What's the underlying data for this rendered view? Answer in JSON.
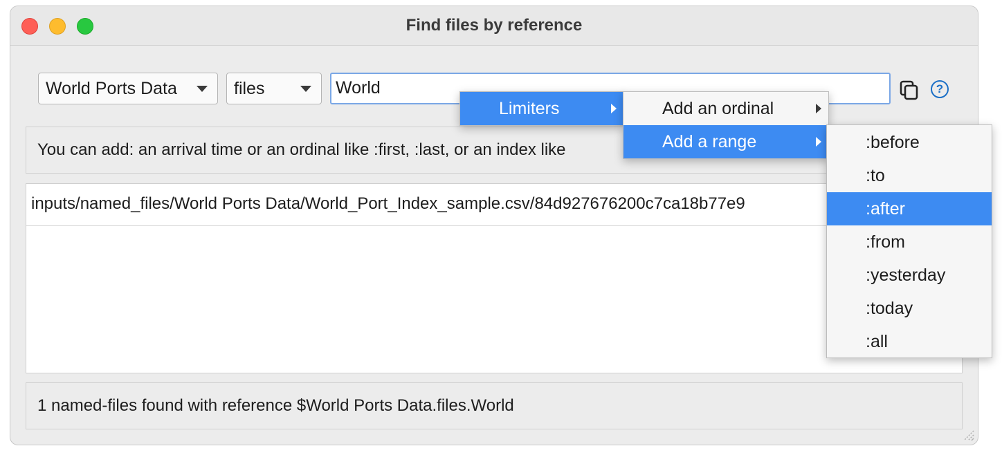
{
  "window": {
    "title": "Find files by reference"
  },
  "toolbar": {
    "dataset_value": "World Ports Data",
    "type_value": "files",
    "search_value": "World",
    "help_glyph": "?"
  },
  "hint": {
    "text": "You can add: an arrival time or an ordinal like :first, :last, or an index like"
  },
  "results": {
    "rows": [
      "inputs/named_files/World Ports Data/World_Port_Index_sample.csv/84d927676200c7ca18b77e9"
    ]
  },
  "status": {
    "text": "1 named-files found with reference $World Ports Data.files.World"
  },
  "context_menu": {
    "level1": [
      {
        "label": "Limiters",
        "active": true,
        "submenu": true
      }
    ],
    "level2": [
      {
        "label": "Add an ordinal",
        "active": false,
        "submenu": true
      },
      {
        "label": "Add a range",
        "active": true,
        "submenu": true
      }
    ],
    "level3": [
      {
        "label": ":before",
        "active": false
      },
      {
        "label": ":to",
        "active": false
      },
      {
        "label": ":after",
        "active": true
      },
      {
        "label": ":from",
        "active": false
      },
      {
        "label": ":yesterday",
        "active": false
      },
      {
        "label": ":today",
        "active": false
      },
      {
        "label": ":all",
        "active": false
      }
    ]
  },
  "colors": {
    "accent": "#3d8bf2",
    "focus_ring": "#7aa7e6",
    "close": "#fe5f57",
    "minimize": "#febc2e",
    "zoom": "#28c840"
  },
  "icons": [
    "copy-icon",
    "help-icon",
    "submenu-arrow-icon",
    "dropdown-arrow-icon",
    "resize-grip-icon"
  ]
}
